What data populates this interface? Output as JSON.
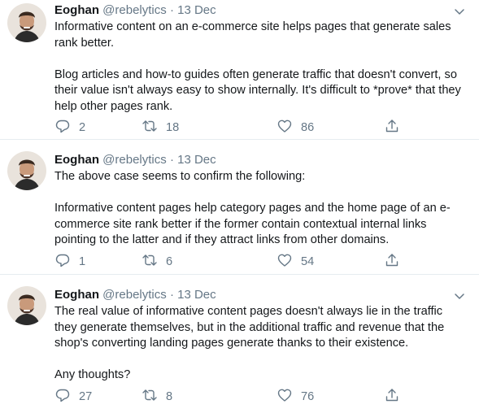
{
  "tweets": [
    {
      "author": {
        "name": "Eoghan",
        "handle": "@rebelytics"
      },
      "separator": "·",
      "date": "13 Dec",
      "paragraphs": [
        "Informative content on an e-commerce site helps pages that generate sales rank better.",
        "Blog articles and how-to guides often generate traffic that doesn't convert, so their value isn't always easy to show internally. It's difficult to *prove* that they help other pages rank."
      ],
      "replies": "2",
      "retweets": "18",
      "likes": "86"
    },
    {
      "author": {
        "name": "Eoghan",
        "handle": "@rebelytics"
      },
      "separator": "·",
      "date": "13 Dec",
      "paragraphs": [
        "The above case seems to confirm the following:",
        "Informative content pages help category pages and the home page of an e-commerce site rank better if the former contain contextual internal links pointing to the latter and if they attract links from other domains."
      ],
      "replies": "1",
      "retweets": "6",
      "likes": "54"
    },
    {
      "author": {
        "name": "Eoghan",
        "handle": "@rebelytics"
      },
      "separator": "·",
      "date": "13 Dec",
      "paragraphs": [
        "The real value of informative content pages doesn't always lie in the traffic they generate themselves, but in the additional traffic and revenue that the shop's converting landing pages generate thanks to their existence.",
        "Any thoughts?"
      ],
      "replies": "27",
      "retweets": "8",
      "likes": "76"
    }
  ],
  "colors": {
    "text": "#14171a",
    "muted": "#657786",
    "divider": "#e6ecf0"
  },
  "icons": [
    "reply-icon",
    "retweet-icon",
    "like-icon",
    "share-icon",
    "chevron-down-icon",
    "avatar"
  ]
}
